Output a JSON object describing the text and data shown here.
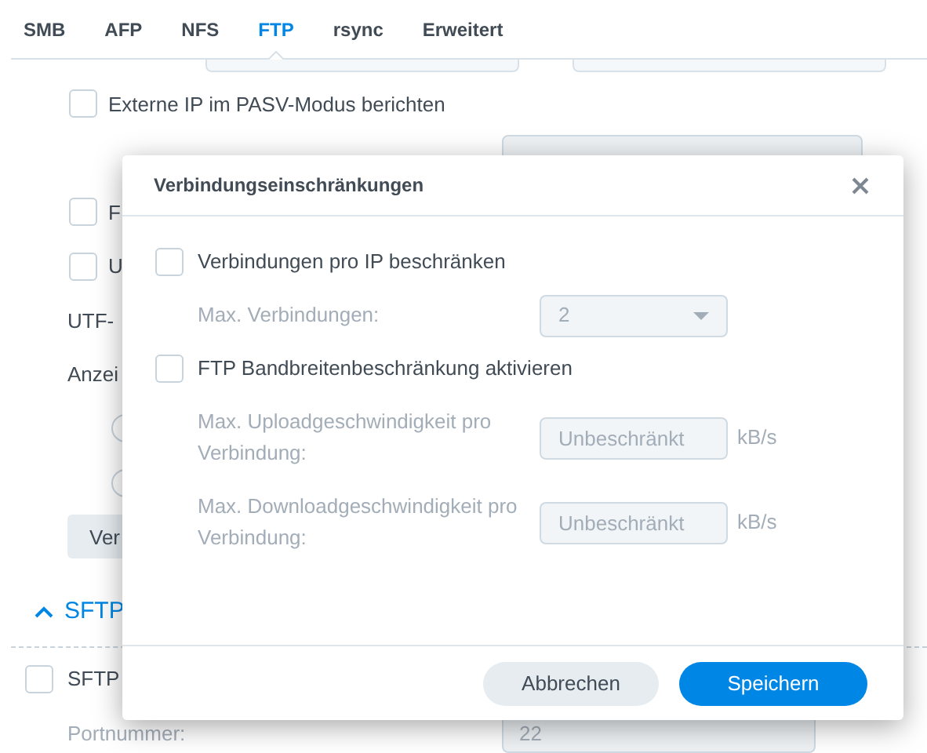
{
  "tabs": [
    {
      "label": "SMB",
      "selected": false
    },
    {
      "label": "AFP",
      "selected": false
    },
    {
      "label": "NFS",
      "selected": false
    },
    {
      "label": "FTP",
      "selected": true
    },
    {
      "label": "rsync",
      "selected": false
    },
    {
      "label": "Erweitert",
      "selected": false
    }
  ],
  "ftp_settings": [
    {
      "kind": "checkbox",
      "label": "Externe IP im PASV-Modus berichten",
      "checked": false
    },
    {
      "kind": "field"
    },
    {
      "kind": "checkbox",
      "label": "F",
      "checked": false
    },
    {
      "kind": "checkbox",
      "label": "U",
      "checked": false
    },
    {
      "kind": "text",
      "label": "UTF-"
    },
    {
      "kind": "text",
      "label": "Anzei"
    },
    {
      "kind": "radio",
      "selected": false
    },
    {
      "kind": "radio",
      "selected": false
    },
    {
      "kind": "button",
      "label": "Ver"
    }
  ],
  "sftp_section": {
    "title": "SFTP",
    "expanded": true,
    "items": [
      {
        "kind": "checkbox",
        "label": "SFTP",
        "checked": false
      },
      {
        "kind": "field",
        "label": "Portnummer:",
        "value": "22",
        "disabled": true
      }
    ]
  },
  "dialog": {
    "title": "Verbindungseinschränkungen",
    "options": [
      {
        "kind": "checkbox",
        "label": "Verbindungen pro IP beschränken",
        "checked": false
      },
      {
        "kind": "select",
        "label": "Max. Verbindungen:",
        "value": "2",
        "disabled": true
      },
      {
        "kind": "checkbox",
        "label": "FTP Bandbreitenbeschränkung aktivieren",
        "checked": false
      },
      {
        "kind": "input",
        "label": "Max. Uploadgeschwindigkeit pro Verbindung:",
        "placeholder": "Unbeschränkt",
        "unit": "kB/s",
        "disabled": true
      },
      {
        "kind": "input",
        "label": "Max. Downloadgeschwindigkeit pro Verbindung:",
        "placeholder": "Unbeschränkt",
        "unit": "kB/s",
        "disabled": true
      }
    ],
    "buttons": [
      {
        "label": "Abbrechen",
        "kind": "secondary"
      },
      {
        "label": "Speichern",
        "kind": "primary"
      }
    ]
  }
}
